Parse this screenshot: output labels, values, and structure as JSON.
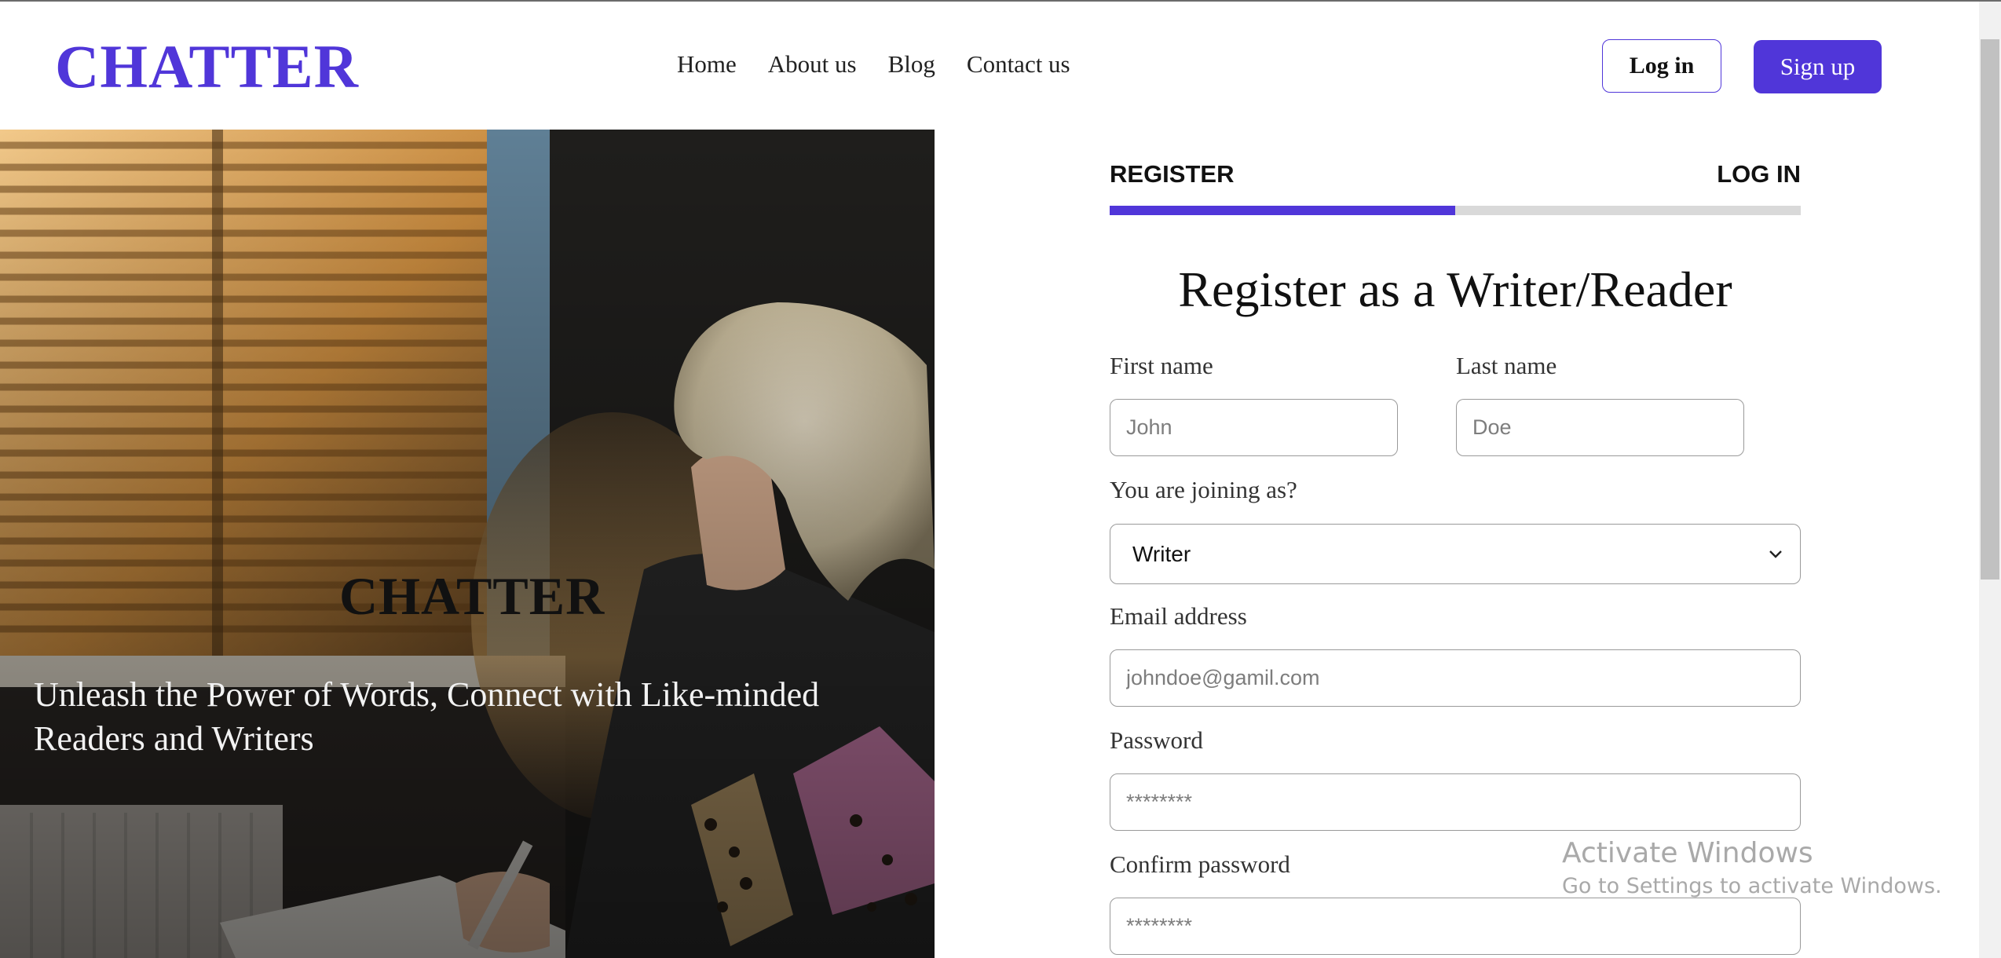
{
  "header": {
    "brand": "CHATTER",
    "nav": [
      {
        "label": "Home"
      },
      {
        "label": "About us"
      },
      {
        "label": "Blog"
      },
      {
        "label": "Contact us"
      }
    ],
    "login_label": "Log in",
    "signup_label": "Sign up"
  },
  "hero": {
    "brand": "CHATTER",
    "tagline": "Unleash the Power of Words, Connect with Like-minded Readers and Writers"
  },
  "auth_tabs": {
    "register": "REGISTER",
    "login": "LOG IN",
    "active_progress": 0.5
  },
  "form": {
    "title": "Register as a Writer/Reader",
    "first_name_label": "First name",
    "first_name_placeholder": "John",
    "last_name_label": "Last name",
    "last_name_placeholder": "Doe",
    "role_label": "You are joining as?",
    "role_selected": "Writer",
    "email_label": "Email address",
    "email_placeholder": "johndoe@gamil.com",
    "password_label": "Password",
    "password_placeholder": "********",
    "confirm_label": "Confirm password",
    "confirm_placeholder": "********"
  },
  "watermark": {
    "line1": "Activate Windows",
    "line2": "Go to Settings to activate Windows."
  },
  "colors": {
    "accent": "#5036d9",
    "tab_track": "#d9d9d9"
  }
}
